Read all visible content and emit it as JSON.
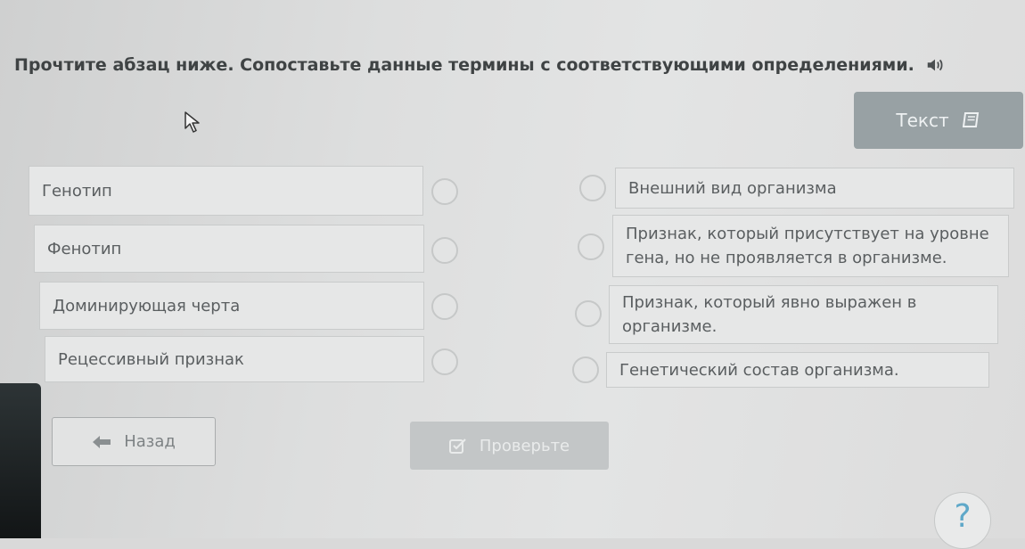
{
  "instruction": "Прочтите абзац ниже. Сопоставьте данные термины с соответствующими определениями.",
  "text_button": {
    "label": "Текст"
  },
  "terms": [
    "Генотип",
    "Фенотип",
    "Доминирующая черта",
    "Рецессивный признак"
  ],
  "definitions": [
    "Внешний вид организма",
    "Признак, который присутствует на уровне гена, но не проявляется в организме.",
    "Признак, который явно выражен в организме.",
    "Генетический состав организма."
  ],
  "back_button": {
    "label": "Назад"
  },
  "check_button": {
    "label": "Проверьте"
  },
  "help_button": {
    "label": "?"
  },
  "colors": {
    "accent_help": "#5fa8c9",
    "button_disabled": "#c3c6c7",
    "text_button_bg": "#98a1a4"
  }
}
